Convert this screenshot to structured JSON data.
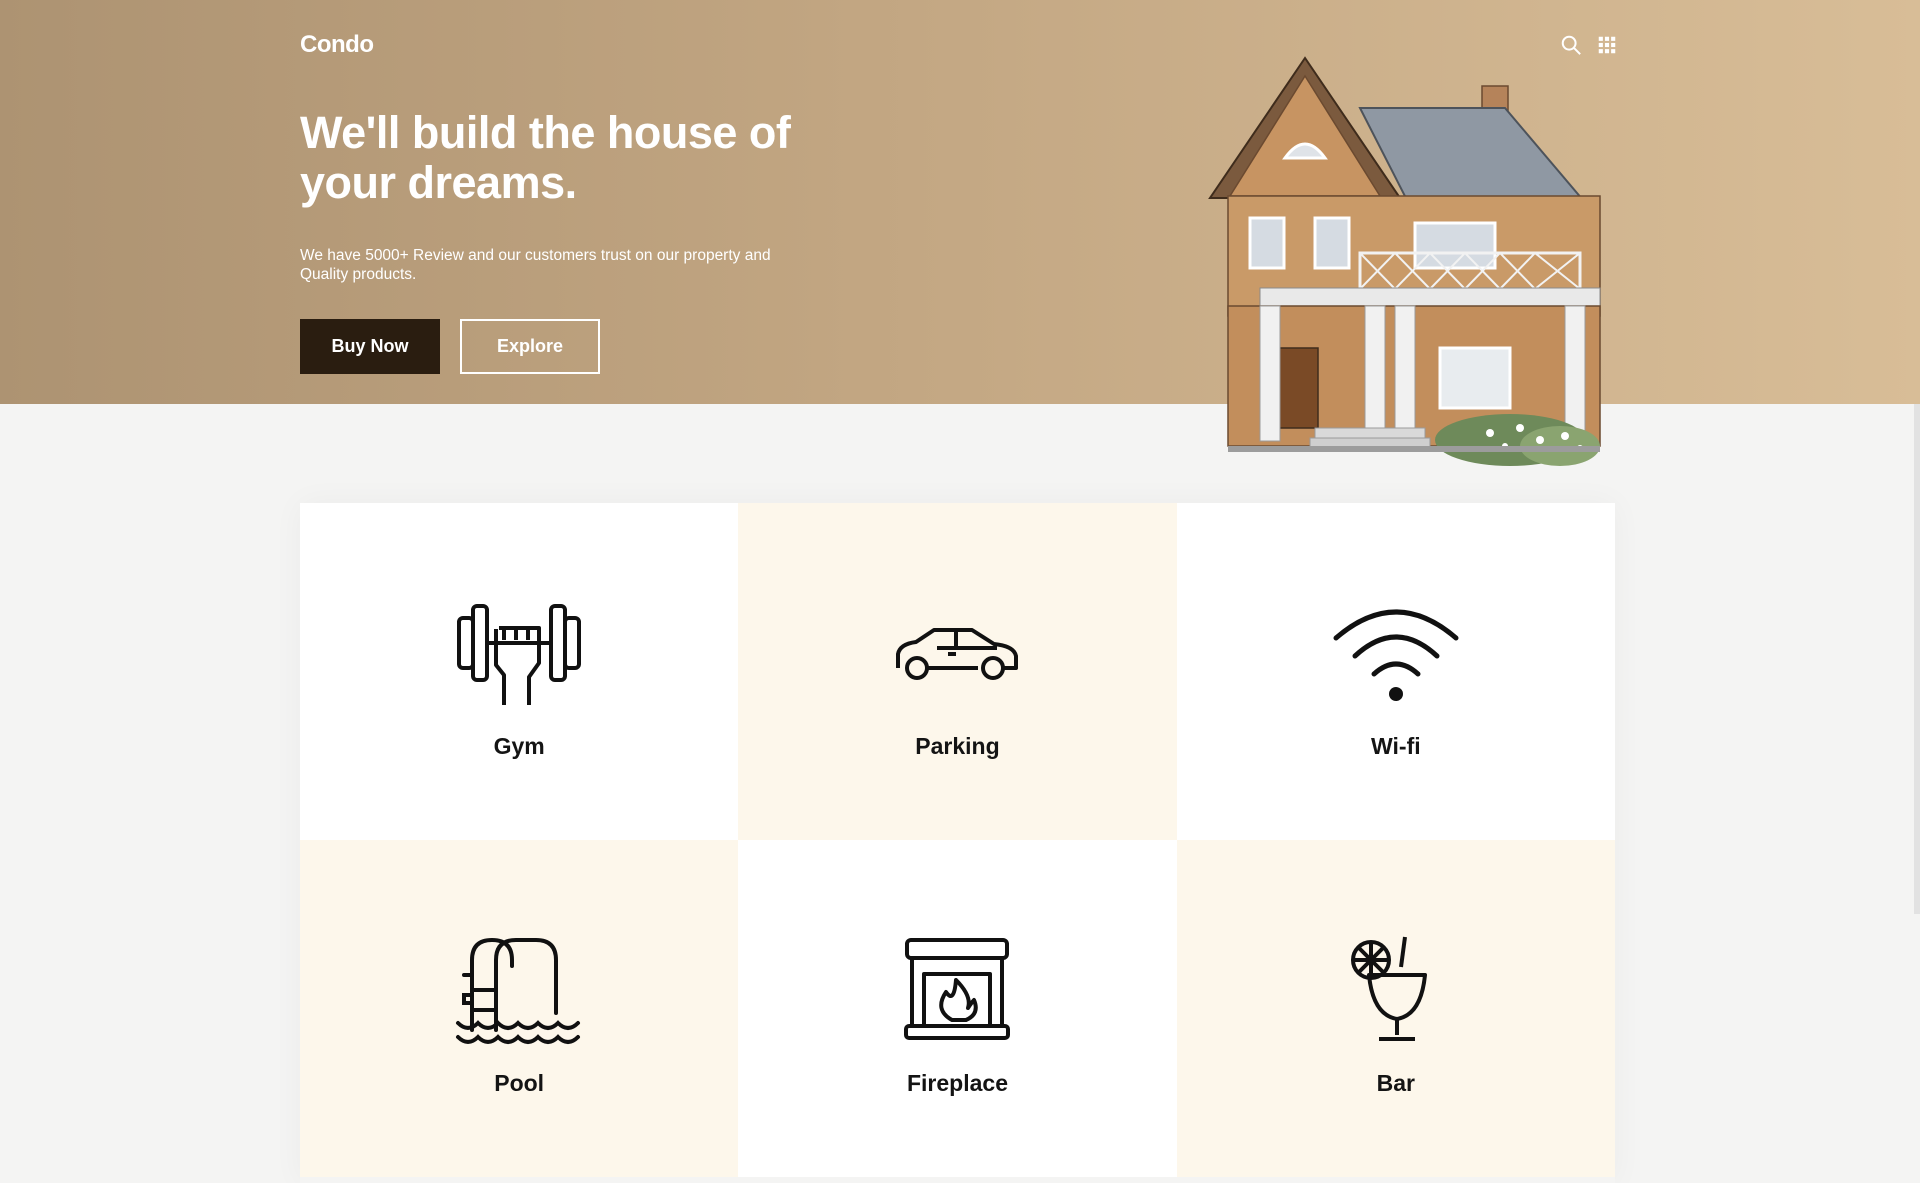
{
  "header": {
    "brand": "Condo",
    "icons": [
      "search-icon",
      "grid-menu-icon"
    ]
  },
  "hero": {
    "headline": "We'll build the house of your dreams.",
    "subtext": "We have 5000+ Review and our customers trust on our property and Quality products.",
    "buy_label": "Buy Now",
    "explore_label": "Explore"
  },
  "amenities": [
    {
      "label": "Gym",
      "icon": "gym-icon"
    },
    {
      "label": "Parking",
      "icon": "car-icon"
    },
    {
      "label": "Wi-fi",
      "icon": "wifi-icon"
    },
    {
      "label": "Pool",
      "icon": "pool-icon"
    },
    {
      "label": "Fireplace",
      "icon": "fireplace-icon"
    },
    {
      "label": "Bar",
      "icon": "cocktail-icon"
    }
  ],
  "colors": {
    "hero_start": "#ad9372",
    "hero_end": "#d8bd97",
    "button_dark": "#2a1d10",
    "card_cream": "#fdf7eb",
    "card_white": "#ffffff"
  }
}
